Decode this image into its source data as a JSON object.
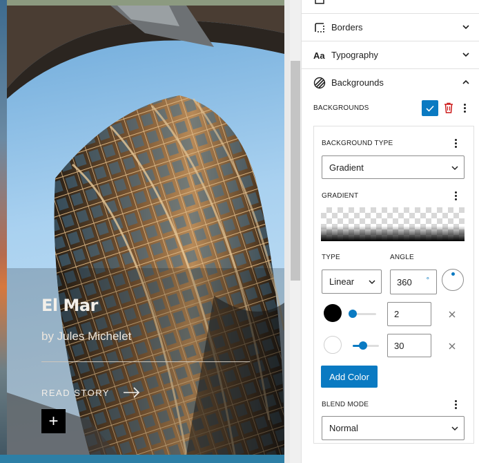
{
  "story": {
    "title": "El Mar",
    "author": "by Jules Michelet",
    "read_label": "READ STORY",
    "add_label": "+"
  },
  "sidebar": {
    "panels": [
      {
        "label": "Borders",
        "icon": "border-icon"
      },
      {
        "label": "Typography",
        "icon": "typography-icon"
      },
      {
        "label": "Backgrounds",
        "icon": "backgrounds-icon"
      }
    ],
    "backgrounds": {
      "header_label": "BACKGROUNDS",
      "background_type_label": "BACKGROUND TYPE",
      "background_type_value": "Gradient",
      "gradient_label": "GRADIENT",
      "type_label": "TYPE",
      "type_value": "Linear",
      "angle_label": "ANGLE",
      "angle_value": "360",
      "angle_unit": "°",
      "stops": [
        {
          "color": "#000000",
          "position": "2",
          "slider_fraction": 0.1
        },
        {
          "color": "#ffffff",
          "position": "30",
          "slider_fraction": 0.4
        }
      ],
      "add_color_label": "Add Color",
      "blend_mode_label": "BLEND MODE",
      "blend_mode_value": "Normal"
    }
  },
  "colors": {
    "accent": "#0a7ac2",
    "danger": "#cc1818"
  }
}
